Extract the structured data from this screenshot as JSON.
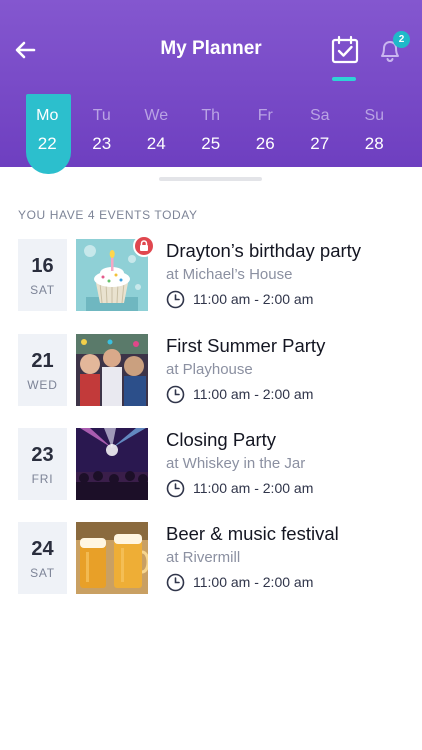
{
  "header": {
    "title": "My Planner",
    "back_icon": "arrow-left-icon",
    "calendar_icon": "calendar-check-icon",
    "bell_icon": "bell-icon",
    "notification_count": "2",
    "accent_color": "#2cbfcd",
    "background_color": "#7a4bc8"
  },
  "week": {
    "days": [
      {
        "dow": "Mo",
        "date": "22",
        "selected": true
      },
      {
        "dow": "Tu",
        "date": "23",
        "selected": false
      },
      {
        "dow": "We",
        "date": "24",
        "selected": false
      },
      {
        "dow": "Th",
        "date": "25",
        "selected": false
      },
      {
        "dow": "Fr",
        "date": "26",
        "selected": false
      },
      {
        "dow": "Sa",
        "date": "27",
        "selected": false
      },
      {
        "dow": "Su",
        "date": "28",
        "selected": false
      }
    ]
  },
  "events_heading": "YOU HAVE 4 EVENTS TODAY",
  "events": [
    {
      "day": "16",
      "dow": "SAT",
      "title": "Drayton’s birthday party",
      "place": "at Michael’s House",
      "time": "11:00 am - 2:00 am",
      "locked": true,
      "thumbnail": "cupcake-photo"
    },
    {
      "day": "21",
      "dow": "WED",
      "title": "First Summer Party",
      "place": "at Playhouse",
      "time": "11:00 am - 2:00 am",
      "locked": false,
      "thumbnail": "party-crowd-photo"
    },
    {
      "day": "23",
      "dow": "FRI",
      "title": "Closing Party",
      "place": "at Whiskey in the Jar",
      "time": "11:00 am - 2:00 am",
      "locked": false,
      "thumbnail": "concert-lights-photo"
    },
    {
      "day": "24",
      "dow": "SAT",
      "title": "Beer & music festival",
      "place": "at Rivermill",
      "time": "11:00 am - 2:00 am",
      "locked": false,
      "thumbnail": "beer-mugs-photo"
    }
  ]
}
